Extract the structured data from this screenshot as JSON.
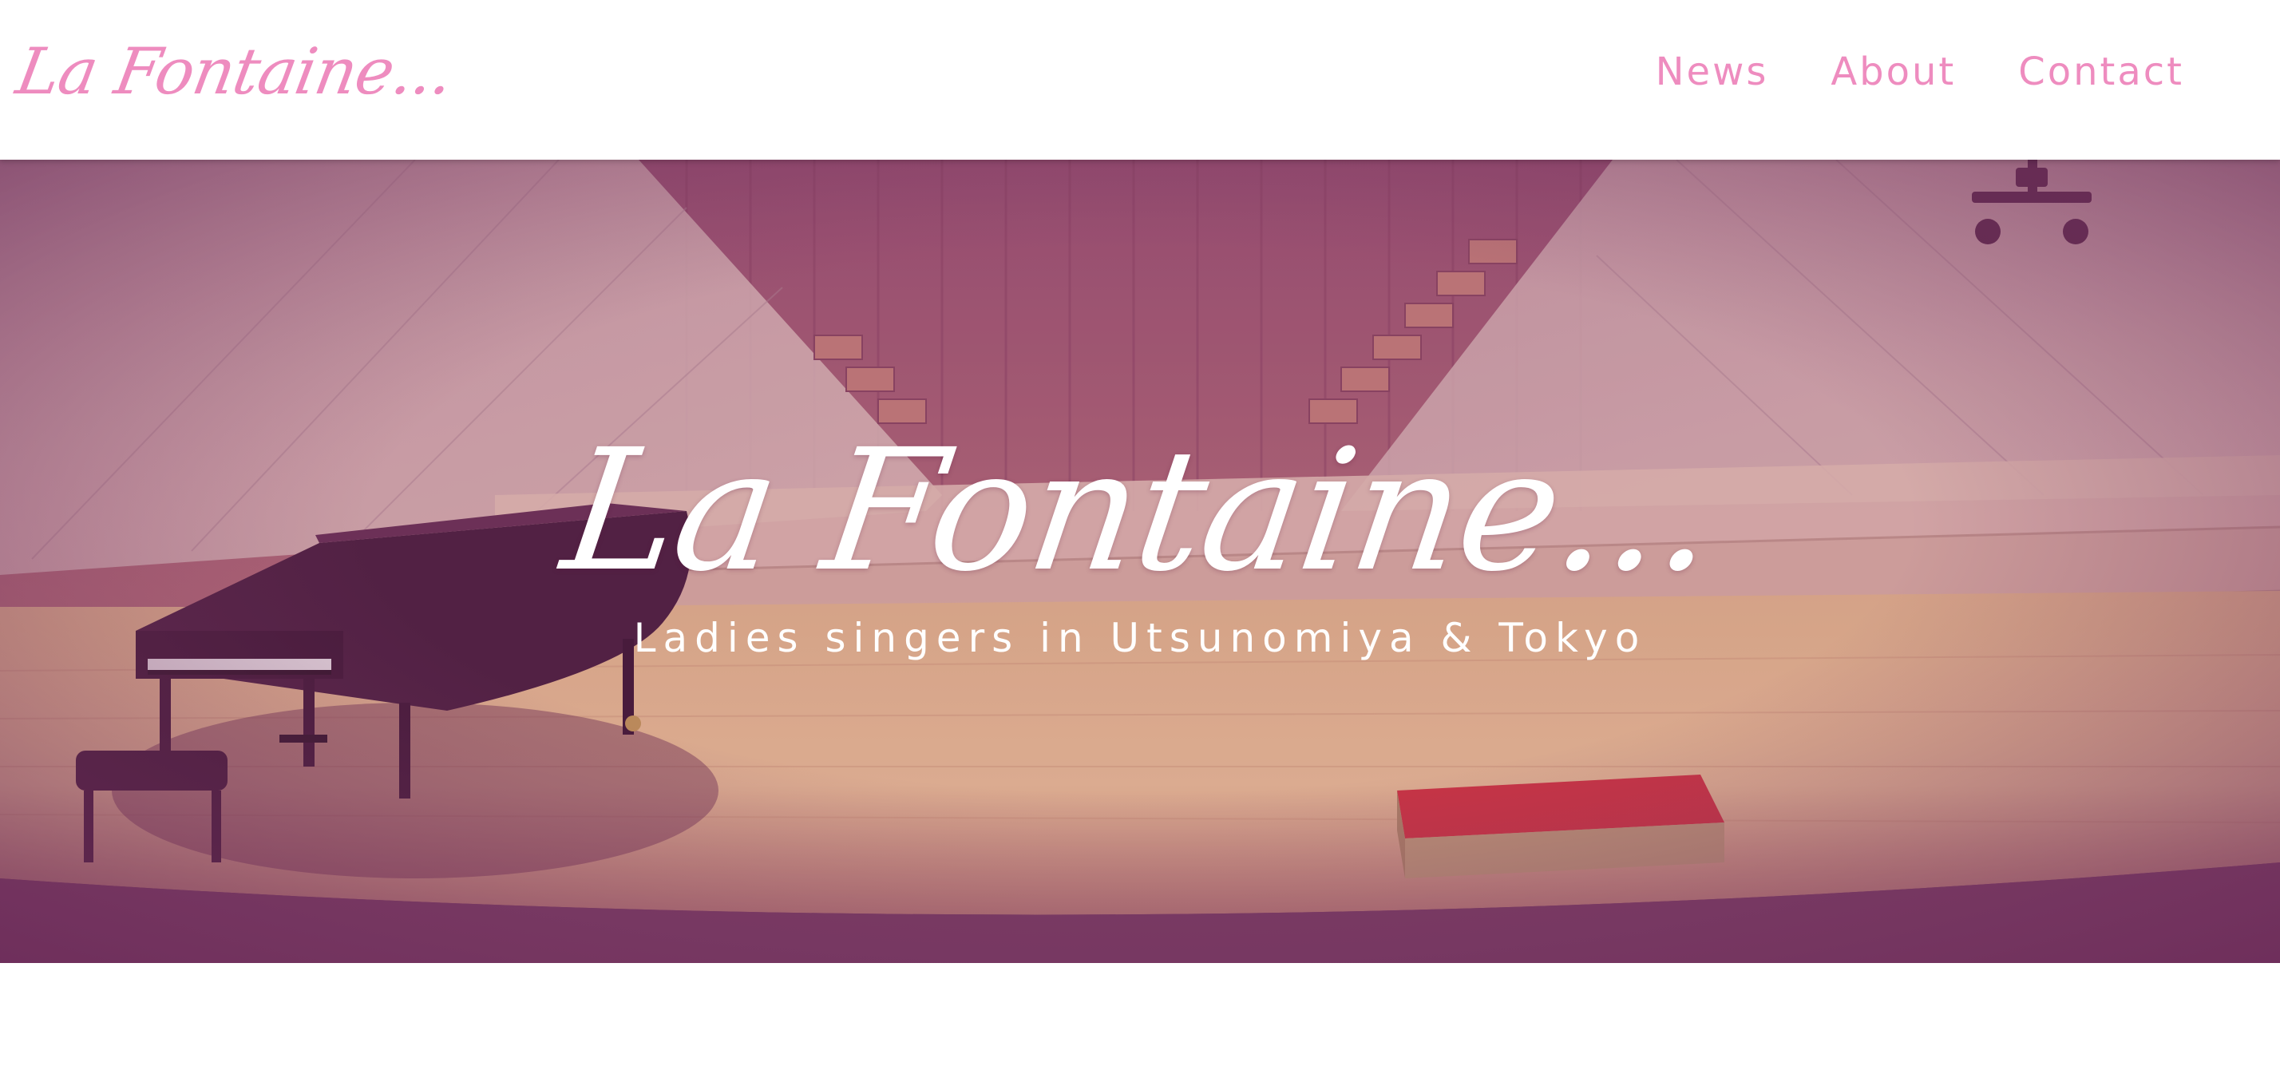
{
  "header": {
    "logo_text": "La Fontaine...",
    "nav": {
      "news_label": "News",
      "about_label": "About",
      "contact_label": "Contact"
    }
  },
  "hero": {
    "title": "La Fontaine...",
    "subtitle": "Ladies singers in Utsunomiya & Tokyo"
  },
  "colors": {
    "brand_pink": "#ee8cbf",
    "overlay_purple": "#7a3b64",
    "stage_floor": "#e8b48c",
    "podium_red": "#d8323f"
  },
  "icons": {
    "piano": "grand-piano-illustration",
    "podium": "red-podium-illustration",
    "light": "stage-light-illustration"
  }
}
